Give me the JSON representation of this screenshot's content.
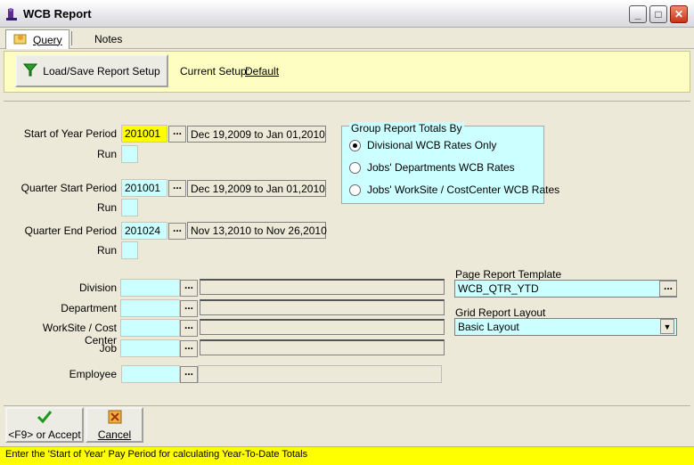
{
  "window": {
    "title": "WCB Report"
  },
  "tabs": {
    "query": "Query",
    "notes": "Notes"
  },
  "toolbar": {
    "load_save_label": "Load/Save Report Setup",
    "current_setup_label": "Current Setup:",
    "current_setup_value": "Default"
  },
  "periods": {
    "start_of_year": {
      "label": "Start of Year Period",
      "value": "201001",
      "range": "Dec 19,2009 to Jan 01,2010",
      "run_label": "Run"
    },
    "quarter_start": {
      "label": "Quarter Start Period",
      "value": "201001",
      "range": "Dec 19,2009 to Jan 01,2010",
      "run_label": "Run"
    },
    "quarter_end": {
      "label": "Quarter End Period",
      "value": "201024",
      "range": "Nov 13,2010 to Nov 26,2010",
      "run_label": "Run"
    }
  },
  "group_totals": {
    "title": "Group Report Totals By",
    "options": [
      {
        "label": "Divisional WCB Rates Only",
        "selected": true
      },
      {
        "label": "Jobs' Departments WCB Rates",
        "selected": false
      },
      {
        "label": "Jobs' WorkSite / CostCenter WCB Rates",
        "selected": false
      }
    ]
  },
  "filters": {
    "division": {
      "label": "Division",
      "value": ""
    },
    "department": {
      "label": "Department",
      "value": ""
    },
    "worksite": {
      "label": "WorkSite / Cost Center",
      "value": ""
    },
    "job": {
      "label": "Job",
      "value": ""
    },
    "employee": {
      "label": "Employee",
      "value": ""
    }
  },
  "template": {
    "label": "Page Report Template",
    "value": "WCB_QTR_YTD"
  },
  "grid_layout": {
    "label": "Grid Report Layout",
    "value": "Basic Layout"
  },
  "buttons": {
    "accept": "<F9> or Accept",
    "cancel": "Cancel"
  },
  "status": "Enter the 'Start of Year' Pay Period for calculating Year-To-Date Totals",
  "colors": {
    "field_bg": "#ccffff",
    "toolbar_bg": "#fffec2",
    "status_bg": "#ffff00"
  },
  "icons": {
    "app": "app-icon",
    "query_tab": "query-icon",
    "load_save": "funnel-icon",
    "accept": "checkmark-icon",
    "cancel": "cancel-icon"
  }
}
